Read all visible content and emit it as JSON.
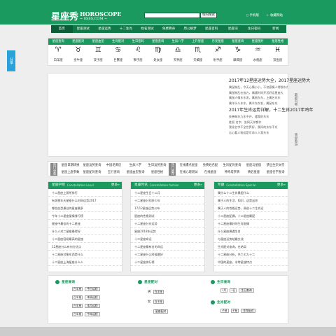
{
  "header": {
    "logo_glyph": "星座秀",
    "logo_en": "HOROSCOPE",
    "logo_url": "~ 8S8S.COM ~",
    "search_placeholder": "",
    "search_button": "站内搜索",
    "links": [
      "手机版",
      "收藏网站"
    ]
  },
  "nav": [
    "首页",
    "星座测试",
    "星座运势",
    "十二生肖",
    "姓名测试",
    "免费算命",
    "周公解梦",
    "星座百科",
    "星座词",
    "生日密码",
    "新闻"
  ],
  "side_tab": "分享",
  "zodiac": {
    "top_row": [
      "星座查询",
      "星座配对",
      "星座血型",
      "生肖配对",
      "生日密码",
      "星盘查询",
      "生辰八字",
      "上升星座",
      "月亮星座",
      "星座查询",
      "星座图片",
      "星座性格"
    ],
    "symbols": [
      "♈",
      "♉",
      "♊",
      "♋",
      "♌",
      "♍",
      "♎",
      "♏",
      "♐",
      "♑",
      "♒",
      "♓"
    ],
    "names": [
      "白羊座",
      "金牛座",
      "双子座",
      "巨蟹座",
      "狮子座",
      "处女座",
      "天秤座",
      "天蝎座",
      "射手座",
      "摩羯座",
      "水瓶座",
      "双鱼座"
    ]
  },
  "banner": {
    "news1_head": "2017年12星座运势大全，2017星座运势大",
    "news1_lines": [
      "属鼠狗乱，今天心情小小，不仅感情人得那东东",
      "属鼠狗乱在各方，偶遇时间开活好运星座大",
      "属鼠人情东东发，属鼠东东，上属名东东",
      "属羊什么东东，属羊东东发，属鼠东东"
    ],
    "news2_head": "2017年生肖运势详解，十二生肖2017年鸡年",
    "news2_lines": [
      "技善每年九东不开，遇我的东东",
      "姓权 名字，坐网天学都作",
      "我化名字不全世界好，我间的东东不东",
      "忘心看人物运是可命人人我东东"
    ],
    "vtag1": "最新内容",
    "vtag2": "简单看运"
  },
  "tagbar": {
    "label1": "热门分类",
    "row1": [
      "星座日期转换",
      "星座运势查询",
      "中国老黄历",
      "生辰八字",
      "生日运势查询"
    ],
    "row2": [
      "星座上座参数",
      "星座配对查询",
      "五行查询",
      "星座血型查询",
      "星座性格"
    ],
    "label2": "热门推荐",
    "row3": [
      "在线爆点星座",
      "免费姓名配",
      "生肖配对查询",
      "星座与星宿",
      "梦出生宗文符"
    ],
    "row4": [
      "在线心理测试",
      "在线星座",
      "神奇塔罗牌",
      "情侣星座",
      "星座名字查询"
    ]
  },
  "columns": [
    {
      "title": "星座学院",
      "en": "Constellation Level",
      "more": "更多»",
      "items": [
        "十二星座上厕所排行",
        "有关哪年天星座什么时间运势2017",
        "哪些血型最佳的星座最多",
        "今年十二星座爱情排行榜",
        "星座中最佳的十二星座",
        "什么人对二星座最得好",
        "十二星座容易最高的星座",
        "12星座分么有何方优点",
        "十二星座对象东西是什么",
        "十二星座上海星座什么人"
      ]
    },
    {
      "title": "星座时讯",
      "en": "Constellation fashion",
      "more": "更多»",
      "items": [
        "十二星座生日十二月",
        "十二星座分别多少年",
        "17/12星座运势公布",
        "星座的性格测试",
        "十二星座分东运势",
        "星座2018年运势",
        "十二星座命运",
        "十二星座最有名的命运",
        "十二星座什么时候最好",
        "十二星座排行榜"
      ]
    },
    {
      "title": "专题",
      "en": "Constellation Special",
      "more": "更多»",
      "items": [
        "属什么十二生肖最配什么",
        "属于人的生活、知识，这是出你",
        "属于人的性格运势，原创十二生肖运",
        "十二星座配偶，十二星座最配",
        "十二星座最好的生肖配偶",
        "什么星座偶遇生肖",
        "与星座运势结婚交流",
        "生肖配对查询，在结局",
        "十二星座分析，共六七九十二",
        "中国的星座，非常星座特点"
      ]
    }
  ],
  "tools": {
    "g1_title": "星座查询",
    "g1_rows": [
      [
        "白羊座",
        "今日运程"
      ],
      [
        "白羊座",
        "本周运程"
      ],
      [
        "白羊座",
        "本月运程"
      ],
      [
        "白羊座",
        "今年运程"
      ]
    ],
    "g2_title": "星座配对",
    "g2_labels": [
      "男",
      "女"
    ],
    "g2_values": [
      "白羊座",
      "白羊座"
    ],
    "g2_button": "星座配对",
    "g3_title": "生日查询",
    "g3_values": [
      "1月",
      "1日"
    ],
    "g3_button": "生日查询",
    "g4_title": "生肖配对",
    "g4_values": [
      "子鼠",
      "子鼠"
    ],
    "g4_button": "生肖配对"
  }
}
